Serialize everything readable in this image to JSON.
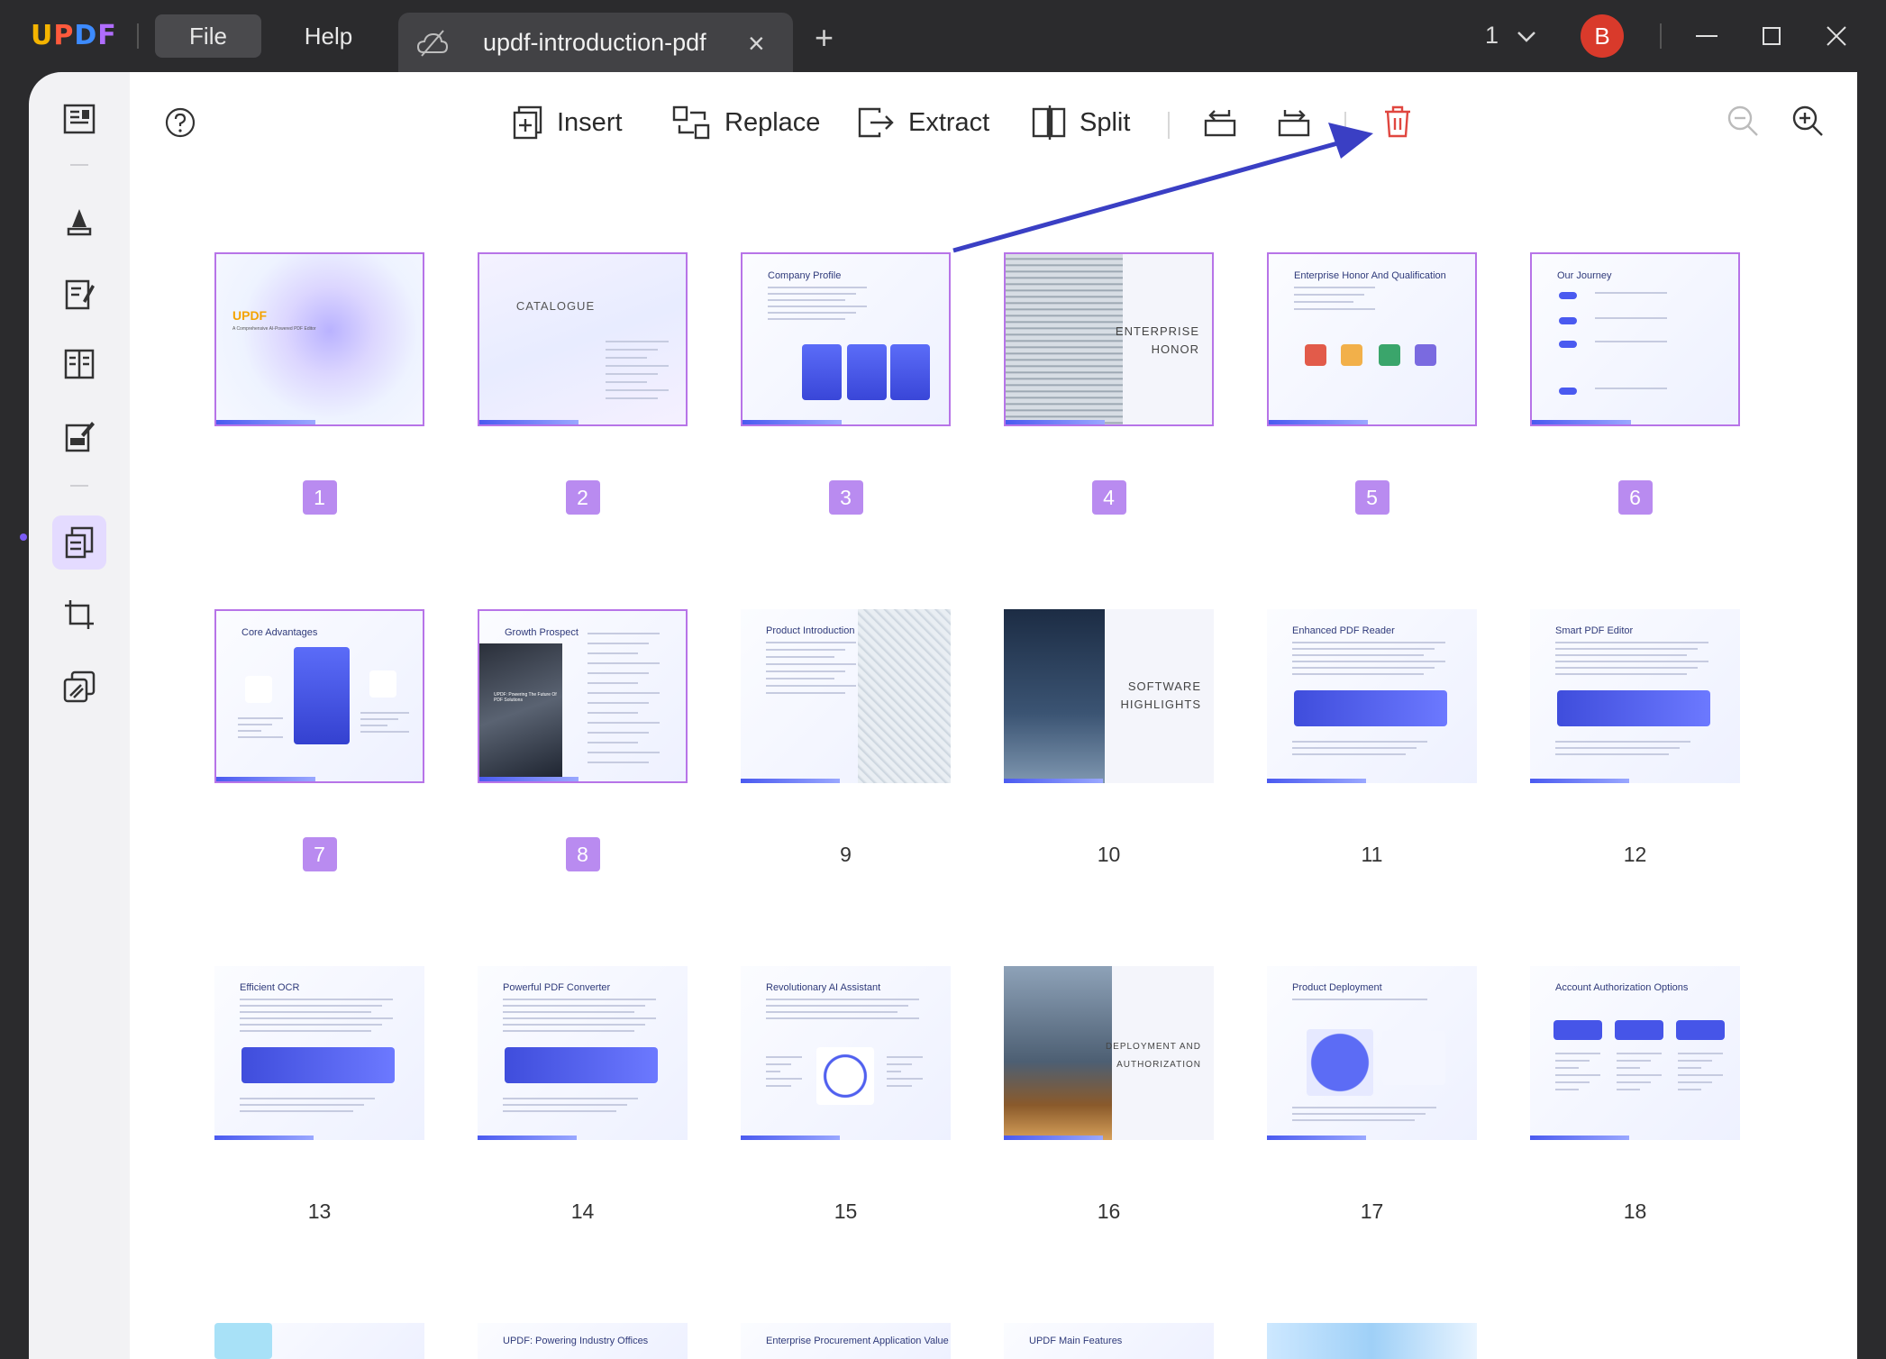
{
  "app": {
    "logo_letters": [
      "U",
      "P",
      "D",
      "F"
    ],
    "menu": {
      "file": "File",
      "help": "Help"
    },
    "tab": {
      "title": "updf-introduction-pdf",
      "close": "×"
    },
    "new_tab": "+",
    "page_selector": "1",
    "avatar_initial": "B"
  },
  "toolbar": {
    "insert": "Insert",
    "replace": "Replace",
    "extract": "Extract",
    "split": "Split"
  },
  "colors": {
    "accent": "#b98bf0",
    "delete": "#e0463f",
    "arrow": "#3a3fc4",
    "titlebar": "#2b2b2d"
  },
  "pages": [
    {
      "number": "1",
      "selected": true,
      "kind": "cover",
      "heading": "UPDF",
      "sub": "A Comprehensive AI-Powered PDF Editor"
    },
    {
      "number": "2",
      "selected": true,
      "kind": "catalogue",
      "heading": "CATALOGUE"
    },
    {
      "number": "3",
      "selected": true,
      "kind": "cards",
      "heading": "Company Profile"
    },
    {
      "number": "4",
      "selected": true,
      "kind": "section",
      "lines": [
        "ENTERPRISE",
        "HONOR"
      ]
    },
    {
      "number": "5",
      "selected": true,
      "kind": "badges",
      "heading": "Enterprise Honor And Qualification"
    },
    {
      "number": "6",
      "selected": true,
      "kind": "timeline",
      "heading": "Our Journey"
    },
    {
      "number": "7",
      "selected": true,
      "kind": "advantages",
      "heading": "Core Advantages"
    },
    {
      "number": "8",
      "selected": true,
      "kind": "growth",
      "heading": "Growth Prospect",
      "caption": "UPDF: Powering The Future Of PDF Solutions"
    },
    {
      "number": "9",
      "selected": false,
      "kind": "intro",
      "heading": "Product Introduction"
    },
    {
      "number": "10",
      "selected": false,
      "kind": "section-dark",
      "lines": [
        "SOFTWARE",
        "HIGHLIGHTS"
      ]
    },
    {
      "number": "11",
      "selected": false,
      "kind": "feature",
      "heading": "Enhanced PDF Reader"
    },
    {
      "number": "12",
      "selected": false,
      "kind": "feature",
      "heading": "Smart PDF Editor"
    },
    {
      "number": "13",
      "selected": false,
      "kind": "feature",
      "heading": "Efficient OCR"
    },
    {
      "number": "14",
      "selected": false,
      "kind": "feature",
      "heading": "Powerful PDF Converter"
    },
    {
      "number": "15",
      "selected": false,
      "kind": "ai",
      "heading": "Revolutionary AI Assistant"
    },
    {
      "number": "16",
      "selected": false,
      "kind": "section-building",
      "lines": [
        "DEPLOYMENT AND",
        "AUTHORIZATION"
      ]
    },
    {
      "number": "17",
      "selected": false,
      "kind": "deploy",
      "heading": "Product Deployment"
    },
    {
      "number": "18",
      "selected": false,
      "kind": "options",
      "heading": "Account Authorization Options"
    },
    {
      "number": "",
      "selected": false,
      "kind": "partial",
      "heading": ""
    },
    {
      "number": "",
      "selected": false,
      "kind": "partial",
      "heading": "UPDF: Powering Industry Offices"
    },
    {
      "number": "",
      "selected": false,
      "kind": "partial",
      "heading": "Enterprise Procurement Application Value"
    },
    {
      "number": "",
      "selected": false,
      "kind": "partial",
      "heading": "UPDF Main Features"
    },
    {
      "number": "",
      "selected": false,
      "kind": "partial",
      "heading": ""
    }
  ]
}
